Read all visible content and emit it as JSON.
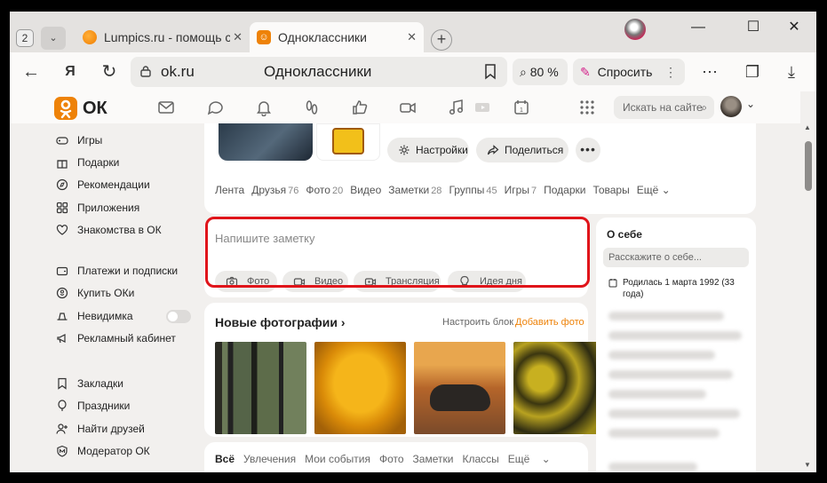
{
  "browser": {
    "tab_count": "2",
    "tabs": [
      {
        "title": "Lumpics.ru - помощь с компьютером"
      },
      {
        "title": "Одноклассники"
      }
    ],
    "address": {
      "url": "ok.ru",
      "title": "Одноклассники"
    },
    "zoom": "80 %",
    "ask_label": "Спросить"
  },
  "ok": {
    "logo_text": "ОК",
    "search_placeholder": "Искать на сайте",
    "menu_groups": [
      [
        "Игры",
        "Подарки",
        "Рекомендации",
        "Приложения",
        "Знакомства в ОК"
      ],
      [
        "Платежи и подписки",
        "Купить ОКи",
        "Невидимка",
        "Рекламный кабинет"
      ],
      [
        "Закладки",
        "Праздники",
        "Найти друзей",
        "Модератор ОК"
      ]
    ],
    "profile": {
      "settings_label": "Настройки",
      "share_label": "Поделиться",
      "more_label": "•••",
      "tabs": [
        {
          "label": "Лента",
          "count": ""
        },
        {
          "label": "Друзья",
          "count": "76"
        },
        {
          "label": "Фото",
          "count": "20"
        },
        {
          "label": "Видео",
          "count": ""
        },
        {
          "label": "Заметки",
          "count": "28"
        },
        {
          "label": "Группы",
          "count": "45"
        },
        {
          "label": "Игры",
          "count": "7"
        },
        {
          "label": "Подарки",
          "count": ""
        },
        {
          "label": "Товары",
          "count": ""
        },
        {
          "label": "Ещё",
          "count": ""
        }
      ]
    },
    "note": {
      "placeholder": "Напишите заметку",
      "buttons": [
        "Фото",
        "Видео",
        "Трансляция",
        "Идея дня"
      ]
    },
    "photos": {
      "title": "Новые фотографии",
      "setup_label": "Настроить блок",
      "add_label": "Добавить фото"
    },
    "feed_tabs": [
      "Всё",
      "Увлечения",
      "Мои события",
      "Фото",
      "Заметки",
      "Классы",
      "Ещё"
    ],
    "about": {
      "title": "О себе",
      "input_placeholder": "Расскажите о себе...",
      "birthday": "Родилась 1 марта 1992 (33 года)"
    }
  },
  "colors": {
    "ok_orange": "#ee8208",
    "highlight_red": "#e0141a",
    "ask_pink": "#d4218a"
  }
}
